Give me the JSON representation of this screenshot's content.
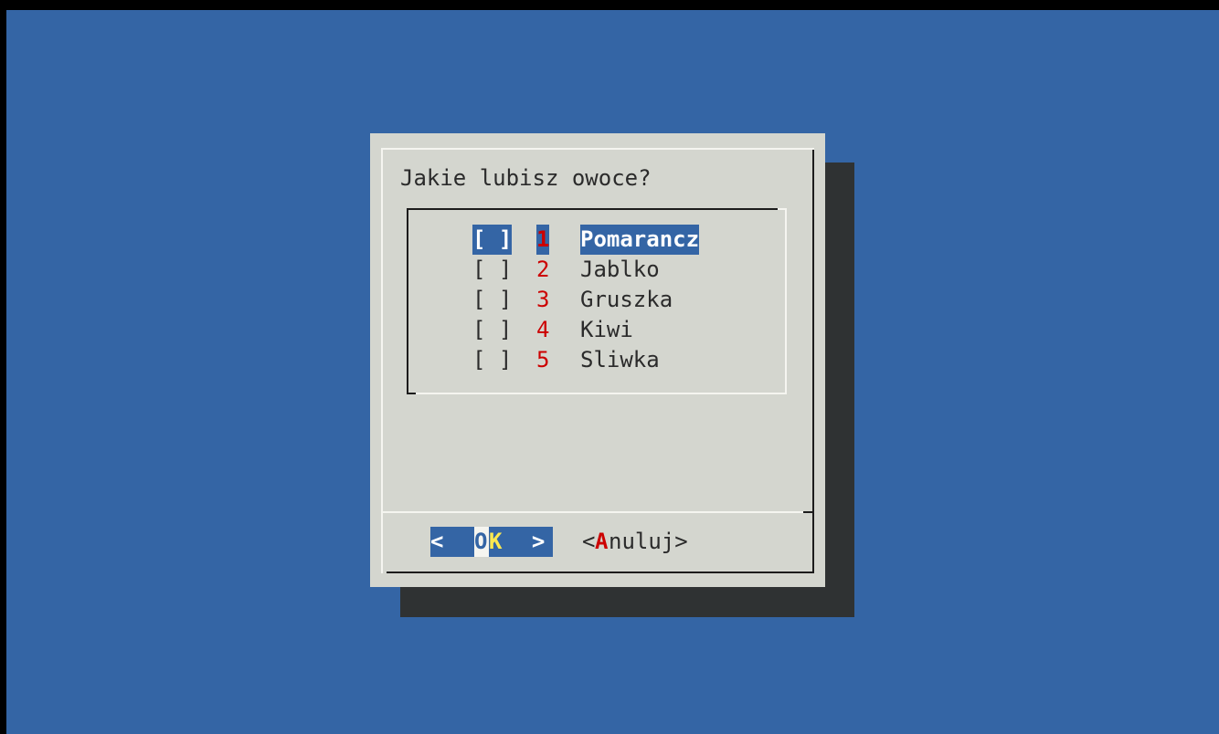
{
  "dialog": {
    "prompt": "Jakie lubisz owoce?",
    "items": [
      {
        "check": "[ ]",
        "key": "1",
        "label": "Pomarancz",
        "selected": true
      },
      {
        "check": "[ ]",
        "key": "2",
        "label": "Jablko",
        "selected": false
      },
      {
        "check": "[ ]",
        "key": "3",
        "label": "Gruszka",
        "selected": false
      },
      {
        "check": "[ ]",
        "key": "4",
        "label": "Kiwi",
        "selected": false
      },
      {
        "check": "[ ]",
        "key": "5",
        "label": "Sliwka",
        "selected": false
      }
    ],
    "ok_button": {
      "left": "< ",
      "hot_pre": "O",
      "hot": "K",
      "right": "  >"
    },
    "cancel_button": {
      "open": "<",
      "hot": "A",
      "rest": "nuluj>"
    }
  },
  "colors": {
    "background": "#3465a5",
    "dialog": "#d4d6cf",
    "shadow": "#2f3233",
    "hotkey": "#cc0000",
    "ok_hotkey": "#fce94f"
  }
}
